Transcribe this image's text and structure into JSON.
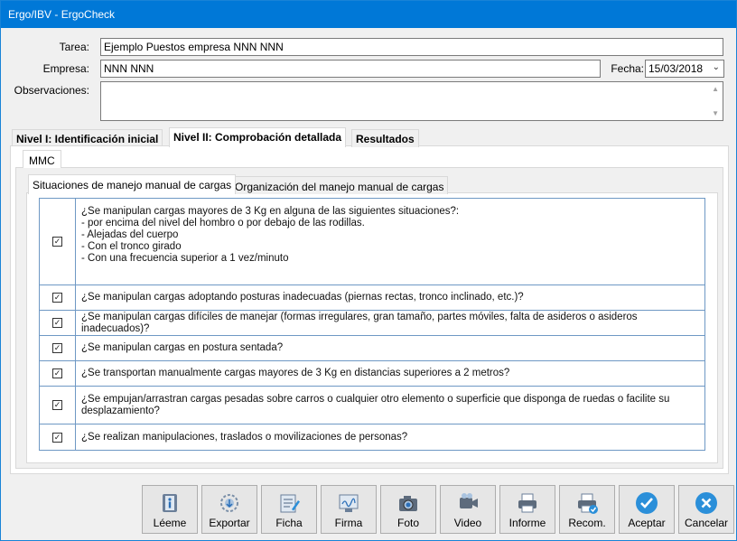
{
  "window": {
    "title": "Ergo/IBV - ErgoCheck"
  },
  "form": {
    "tarea_label": "Tarea:",
    "tarea_value": "Ejemplo Puestos empresa NNN NNN",
    "empresa_label": "Empresa:",
    "empresa_value": "NNN NNN",
    "fecha_label": "Fecha:",
    "fecha_value": "15/03/2018",
    "observaciones_label": "Observaciones:",
    "observaciones_value": ""
  },
  "main_tabs": [
    {
      "label": "Nivel I: Identificación inicial",
      "active": false
    },
    {
      "label": "Nivel II: Comprobación detallada",
      "active": true
    },
    {
      "label": "Resultados",
      "active": false
    }
  ],
  "sub_tab": {
    "label": "MMC"
  },
  "inner_tabs": [
    {
      "label": "Situaciones de manejo manual de cargas",
      "active": true
    },
    {
      "label": "Organización del manejo manual de cargas",
      "active": false
    }
  ],
  "questions": [
    {
      "checked": true,
      "text": "¿Se manipulan cargas mayores de 3 Kg en alguna de las siguientes situaciones?:\n- por encima del nivel del hombro o por debajo de las rodillas.\n- Alejadas del cuerpo\n- Con el tronco girado\n- Con una frecuencia superior a 1 vez/minuto"
    },
    {
      "checked": true,
      "text": "¿Se manipulan cargas adoptando posturas inadecuadas (piernas rectas, tronco inclinado, etc.)?"
    },
    {
      "checked": true,
      "text": "¿Se manipulan cargas difíciles de manejar (formas irregulares, gran tamaño, partes móviles, falta de asideros o asideros inadecuados)?"
    },
    {
      "checked": true,
      "text": "¿Se manipulan cargas en postura sentada?"
    },
    {
      "checked": true,
      "text": "¿Se transportan manualmente cargas mayores de 3 Kg en distancias superiores a 2 metros?"
    },
    {
      "checked": true,
      "text": "¿Se empujan/arrastran cargas pesadas sobre carros o cualquier otro elemento o superficie que disponga de ruedas o facilite su\ndesplazamiento?"
    },
    {
      "checked": true,
      "text": "¿Se realizan manipulaciones, traslados o movilizaciones de personas?"
    }
  ],
  "buttons": [
    {
      "label": "Léeme",
      "icon": "info-icon"
    },
    {
      "label": "Exportar",
      "icon": "export-icon"
    },
    {
      "label": "Ficha",
      "icon": "form-icon"
    },
    {
      "label": "Firma",
      "icon": "signature-icon"
    },
    {
      "label": "Foto",
      "icon": "camera-icon"
    },
    {
      "label": "Video",
      "icon": "video-camera-icon"
    },
    {
      "label": "Informe",
      "icon": "printer-icon"
    },
    {
      "label": "Recom.",
      "icon": "printer-check-icon"
    },
    {
      "label": "Aceptar",
      "icon": "check-icon"
    },
    {
      "label": "Cancelar",
      "icon": "cancel-icon"
    }
  ],
  "colors": {
    "titlebar": "#0078d7",
    "table_border": "#6e98c4",
    "accent_blue": "#2b8fd9"
  }
}
